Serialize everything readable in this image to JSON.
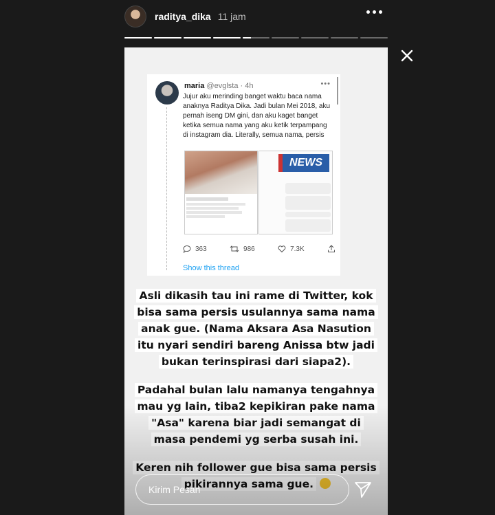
{
  "header": {
    "username": "raditya_dika",
    "time": "11 jam",
    "more_icon": "more-horizontal-icon",
    "close_icon": "close-icon"
  },
  "progress": {
    "total_segments": 9,
    "current_segment": 5,
    "current_fraction": 0.3
  },
  "tweet": {
    "author_name": "maria",
    "author_handle": "@evglsta",
    "time": "4h",
    "text": "Jujur aku merinding banget waktu baca nama anaknya Raditya Dika. Jadi bulan Mei 2018, aku pernah iseng DM gini, dan aku kaget banget ketika semua nama yang aku ketik terpampang di instagram dia. Literally, semua nama, persis",
    "news_label": "NEWS",
    "reply_count": "363",
    "retweet_count": "986",
    "like_count": "7.3K",
    "show_thread": "Show this thread"
  },
  "caption": {
    "para1": [
      "Asli dikasih tau ini rame di Twitter, kok",
      "bisa sama persis usulannya sama nama",
      "anak gue. (Nama Aksara Asa Nasution",
      "itu nyari sendiri bareng Anissa btw jadi",
      "bukan terinspirasi dari siapa2)."
    ],
    "para2": [
      "Padahal bulan lalu namanya tengahnya",
      "mau yg lain, tiba2 kepikiran pake nama",
      "\"Asa\" karena biar jadi semangat di",
      "masa pendemi yg serba susah ini."
    ],
    "para3": [
      "Keren nih follower gue bisa sama persis",
      "pikirannya sama gue."
    ]
  },
  "reply": {
    "placeholder": "Kirim Pesan",
    "send_icon": "send-icon"
  },
  "colors": {
    "background": "#1a1a1a",
    "story_bg": "#f1f1f1",
    "link_blue": "#1da1f2",
    "news_blue": "#2a5ea8"
  }
}
